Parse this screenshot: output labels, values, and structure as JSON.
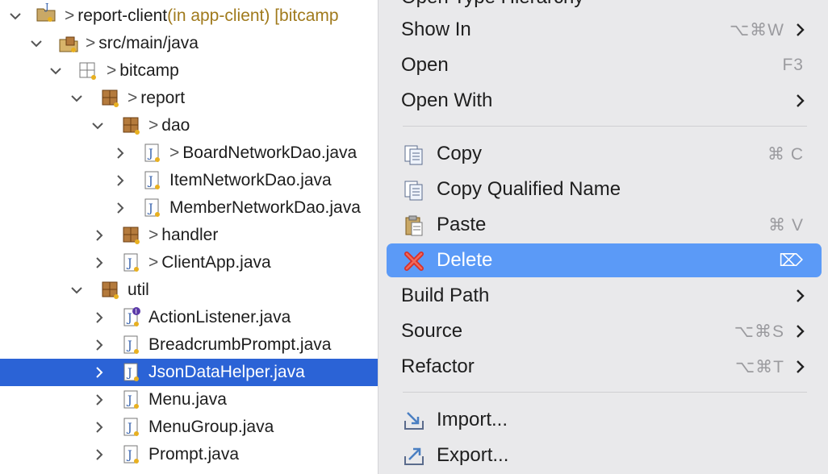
{
  "tree": {
    "rows": [
      {
        "label": "report-client",
        "suffix": " (in app-client) [bitcamp",
        "dirty": ">"
      },
      {
        "label": "src/main/java",
        "dirty": ">"
      },
      {
        "label": "bitcamp",
        "dirty": ">"
      },
      {
        "label": "report",
        "dirty": ">"
      },
      {
        "label": "dao",
        "dirty": ">"
      },
      {
        "label": "BoardNetworkDao.java",
        "dirty": ">"
      },
      {
        "label": "ItemNetworkDao.java"
      },
      {
        "label": "MemberNetworkDao.java"
      },
      {
        "label": "handler",
        "dirty": ">"
      },
      {
        "label": "ClientApp.java",
        "dirty": ">"
      },
      {
        "label": "util"
      },
      {
        "label": "ActionListener.java"
      },
      {
        "label": "BreadcrumbPrompt.java"
      },
      {
        "label": "JsonDataHelper.java"
      },
      {
        "label": "Menu.java"
      },
      {
        "label": "MenuGroup.java"
      },
      {
        "label": "Prompt.java"
      }
    ]
  },
  "menu": {
    "top_partial": "Open Type Hierarchy",
    "items": {
      "show_in": {
        "label": "Show In",
        "shortcut": "⌥⌘W"
      },
      "open": {
        "label": "Open",
        "shortcut": "F3"
      },
      "open_with": {
        "label": "Open With"
      },
      "copy": {
        "label": "Copy",
        "shortcut": "⌘ C"
      },
      "copy_qualified": {
        "label": "Copy Qualified Name"
      },
      "paste": {
        "label": "Paste",
        "shortcut": "⌘ V"
      },
      "delete": {
        "label": "Delete",
        "shortcut": "⌦"
      },
      "build_path": {
        "label": "Build Path"
      },
      "source": {
        "label": "Source",
        "shortcut": "⌥⌘S"
      },
      "refactor": {
        "label": "Refactor",
        "shortcut": "⌥⌘T"
      },
      "import": {
        "label": "Import..."
      },
      "export": {
        "label": "Export..."
      }
    }
  },
  "colors": {
    "selection": "#2b63d6",
    "menu_highlight": "#5b9af7",
    "menu_bg": "#e9e9eb"
  }
}
